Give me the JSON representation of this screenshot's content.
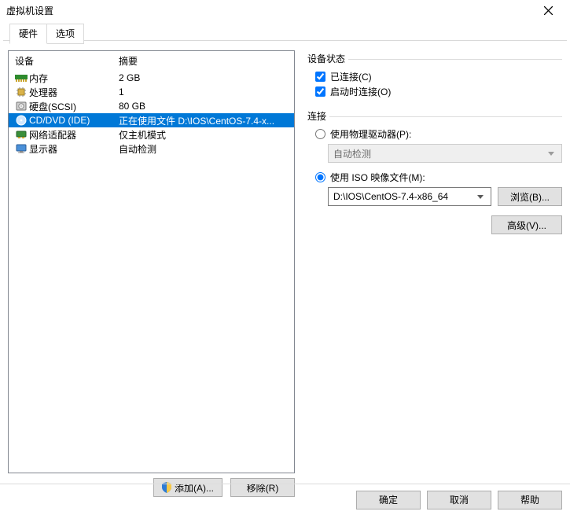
{
  "window": {
    "title": "虚拟机设置"
  },
  "tabs": [
    {
      "id": "hardware",
      "label": "硬件",
      "active": true
    },
    {
      "id": "options",
      "label": "选项",
      "active": false
    }
  ],
  "list": {
    "headers": {
      "device": "设备",
      "summary": "摘要"
    },
    "items": [
      {
        "icon": "memory-icon",
        "device": "内存",
        "summary": "2 GB",
        "selected": false
      },
      {
        "icon": "cpu-icon",
        "device": "处理器",
        "summary": "1",
        "selected": false
      },
      {
        "icon": "disk-icon",
        "device": "硬盘(SCSI)",
        "summary": "80 GB",
        "selected": false
      },
      {
        "icon": "cd-icon",
        "device": "CD/DVD (IDE)",
        "summary": "正在使用文件 D:\\IOS\\CentOS-7.4-x...",
        "selected": true
      },
      {
        "icon": "network-icon",
        "device": "网络适配器",
        "summary": "仅主机模式",
        "selected": false
      },
      {
        "icon": "display-icon",
        "device": "显示器",
        "summary": "自动检测",
        "selected": false
      }
    ],
    "buttons": {
      "add": "添加(A)...",
      "remove": "移除(R)"
    }
  },
  "right": {
    "device_state": {
      "title": "设备状态",
      "connected": {
        "label": "已连接(C)",
        "checked": true
      },
      "connect_at_on": {
        "label": "启动时连接(O)",
        "checked": true
      }
    },
    "connection": {
      "title": "连接",
      "physical": {
        "label": "使用物理驱动器(P):",
        "checked": false,
        "combo_value": "自动检测"
      },
      "iso": {
        "label": "使用 ISO 映像文件(M):",
        "checked": true,
        "combo_value": "D:\\IOS\\CentOS-7.4-x86_64",
        "browse": "浏览(B)..."
      },
      "advanced": "高级(V)..."
    }
  },
  "footer": {
    "ok": "确定",
    "cancel": "取消",
    "help": "帮助"
  }
}
